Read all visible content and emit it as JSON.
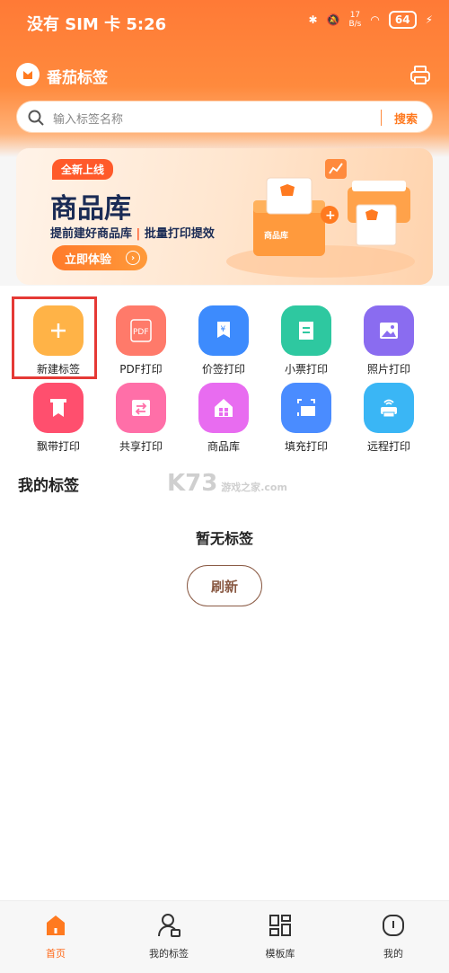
{
  "status_bar": {
    "left": "没有 SIM 卡 5:26",
    "speed_top": "17",
    "speed_unit": "B/s",
    "battery": "64"
  },
  "app": {
    "title": "番茄标签"
  },
  "search": {
    "placeholder": "输入标签名称",
    "button": "搜索"
  },
  "banner": {
    "tag": "全新上线",
    "title": "商品库",
    "subtitle_a": "提前建好商品库",
    "subtitle_sep": "|",
    "subtitle_b": "批量打印提效",
    "cta": "立即体验",
    "box_label": "商品库"
  },
  "grid": [
    {
      "label": "新建标签",
      "icon": "plus-icon",
      "color": "#ffb347"
    },
    {
      "label": "PDF打印",
      "icon": "pdf-icon",
      "color": "#ff7a6a"
    },
    {
      "label": "价签打印",
      "icon": "price-tag-icon",
      "color": "#3d8bfd"
    },
    {
      "label": "小票打印",
      "icon": "receipt-icon",
      "color": "#2ec8a0"
    },
    {
      "label": "照片打印",
      "icon": "photo-icon",
      "color": "#8a6cf0"
    },
    {
      "label": "飘带打印",
      "icon": "ribbon-icon",
      "color": "#ff4f6e"
    },
    {
      "label": "共享打印",
      "icon": "share-icon",
      "color": "#ff6fa8"
    },
    {
      "label": "商品库",
      "icon": "store-icon",
      "color": "#e86cf0"
    },
    {
      "label": "填充打印",
      "icon": "fill-print-icon",
      "color": "#4a8cff"
    },
    {
      "label": "远程打印",
      "icon": "remote-print-icon",
      "color": "#3ab6f5"
    }
  ],
  "section": {
    "title": "我的标签"
  },
  "empty": {
    "text": "暂无标签",
    "refresh": "刷新"
  },
  "watermark": {
    "main": "K73",
    "sub": "游戏之家",
    "domain": ".com"
  },
  "tabs": [
    {
      "label": "首页",
      "active": true
    },
    {
      "label": "我的标签",
      "active": false
    },
    {
      "label": "模板库",
      "active": false
    },
    {
      "label": "我的",
      "active": false
    }
  ],
  "colors": {
    "accent": "#ff7a20",
    "highlight": "#e53935"
  }
}
